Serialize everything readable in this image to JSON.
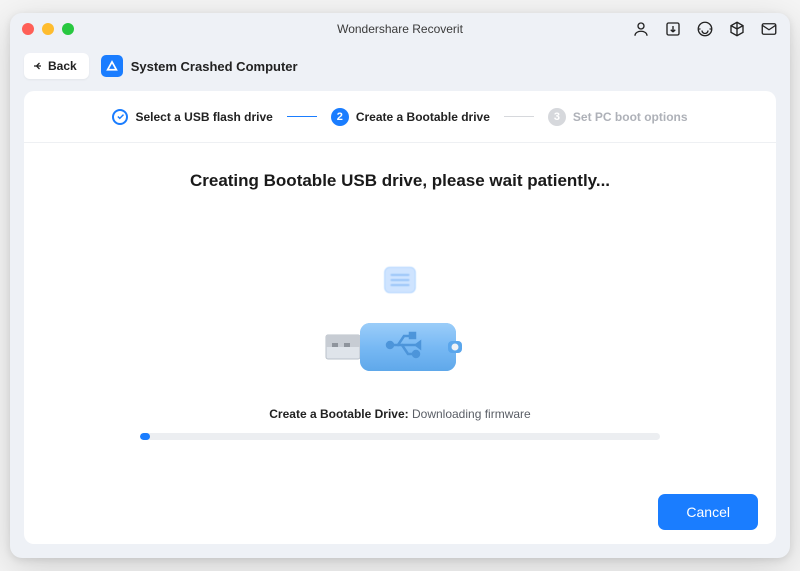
{
  "app": {
    "title": "Wondershare Recoverit"
  },
  "header": {
    "back_label": "Back",
    "breadcrumb": "System Crashed Computer"
  },
  "stepper": {
    "step1": {
      "label": "Select a USB flash drive",
      "state": "done"
    },
    "step2": {
      "label": "Create a Bootable drive",
      "state": "active",
      "number": "2"
    },
    "step3": {
      "label": "Set PC boot options",
      "state": "pending",
      "number": "3"
    }
  },
  "main": {
    "heading": "Creating Bootable USB drive, please wait patiently...",
    "progress_label": "Create a Bootable Drive:",
    "progress_status": " Downloading firmware",
    "progress_percent": 2
  },
  "footer": {
    "cancel_label": "Cancel"
  }
}
